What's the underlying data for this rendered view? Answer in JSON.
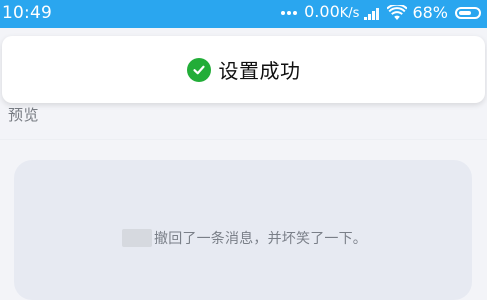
{
  "status_bar": {
    "time": "10:49",
    "net_speed_value": "0.00",
    "net_speed_unit": "K/s",
    "battery_percent": "68%",
    "battery_level": 0.68,
    "icons": [
      "more-dots-icon",
      "signal-icon",
      "wifi-icon",
      "battery-icon"
    ],
    "background_color": "#2aa6ef"
  },
  "toast": {
    "message": "设置成功",
    "icon": "check-circle-icon",
    "icon_color": "#22ad38"
  },
  "preview": {
    "label": "预览",
    "recall_message": "撤回了一条消息，并坏笑了一下。"
  }
}
